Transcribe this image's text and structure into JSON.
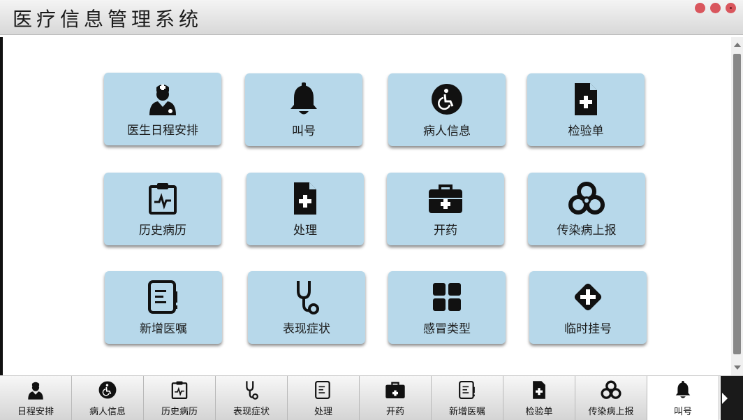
{
  "app": {
    "title": "医疗信息管理系统"
  },
  "cards": [
    {
      "label": "医生日程安排",
      "icon": "doctor-icon"
    },
    {
      "label": "叫号",
      "icon": "bell-icon"
    },
    {
      "label": "病人信息",
      "icon": "wheelchair-icon"
    },
    {
      "label": "检验单",
      "icon": "medical-file-icon"
    },
    {
      "label": "历史病历",
      "icon": "clipboard-pulse-icon"
    },
    {
      "label": "处理",
      "icon": "medical-file-icon"
    },
    {
      "label": "开药",
      "icon": "medkit-icon"
    },
    {
      "label": "传染病上报",
      "icon": "biohazard-icon"
    },
    {
      "label": "新增医嘱",
      "icon": "note-icon"
    },
    {
      "label": "表现症状",
      "icon": "stethoscope-icon"
    },
    {
      "label": "感冒类型",
      "icon": "grid-icon"
    },
    {
      "label": "临时挂号",
      "icon": "plus-diamond-icon"
    }
  ],
  "tabs": [
    {
      "label": "日程安排",
      "icon": "doctor-icon"
    },
    {
      "label": "病人信息",
      "icon": "wheelchair-icon"
    },
    {
      "label": "历史病历",
      "icon": "clipboard-pulse-icon"
    },
    {
      "label": "表现症状",
      "icon": "stethoscope-icon"
    },
    {
      "label": "处理",
      "icon": "note-icon"
    },
    {
      "label": "开药",
      "icon": "medkit-icon"
    },
    {
      "label": "新增医嘱",
      "icon": "note-icon"
    },
    {
      "label": "检验单",
      "icon": "medical-file-icon"
    },
    {
      "label": "传染病上报",
      "icon": "biohazard-icon"
    },
    {
      "label": "叫号",
      "icon": "bell-icon"
    }
  ],
  "colors": {
    "card": "#b7d8ea",
    "icon": "#111111",
    "close": "#d9565d"
  }
}
